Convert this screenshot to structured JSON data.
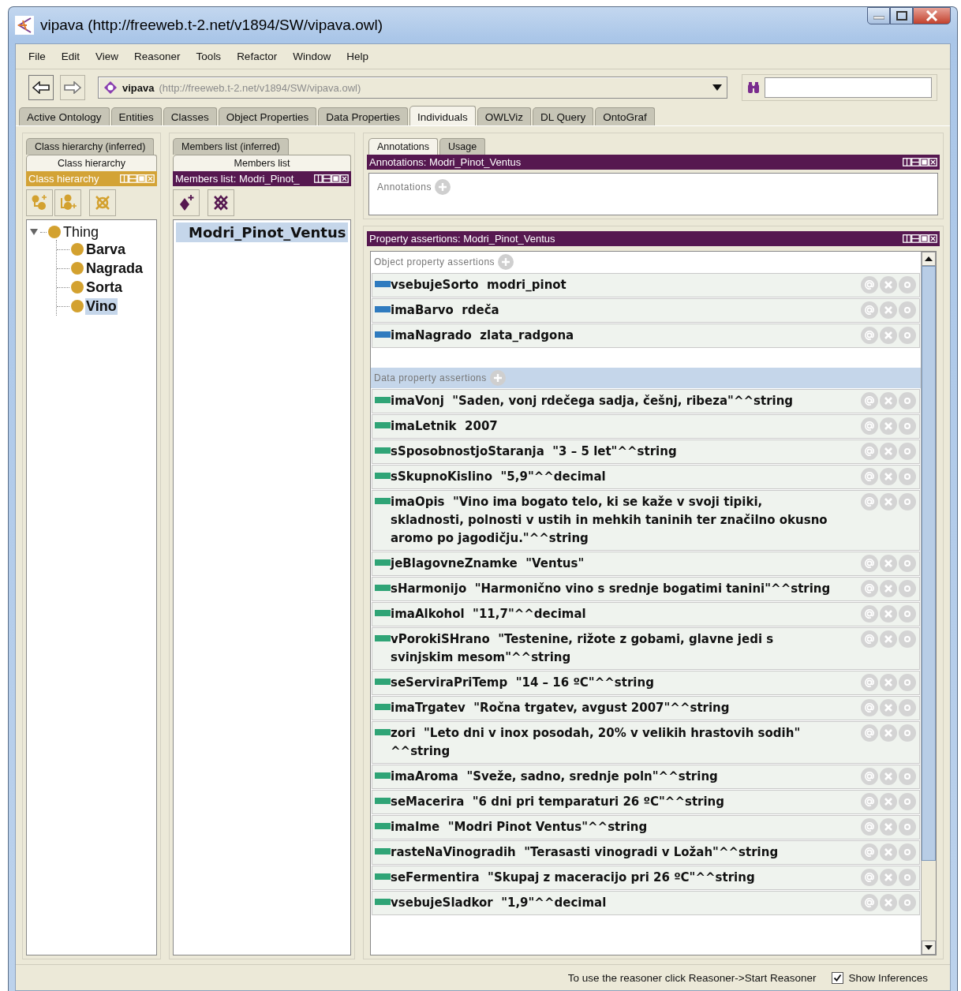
{
  "window": {
    "title": "vipava (http://freeweb.t-2.net/v1894/SW/vipava.owl)"
  },
  "menu": [
    "File",
    "Edit",
    "View",
    "Reasoner",
    "Tools",
    "Refactor",
    "Window",
    "Help"
  ],
  "toolbar": {
    "ontology_name": "vipava",
    "ontology_iri": "(http://freeweb.t-2.net/v1894/SW/vipava.owl)"
  },
  "tabs": [
    {
      "label": "Active Ontology",
      "selected": false
    },
    {
      "label": "Entities",
      "selected": false
    },
    {
      "label": "Classes",
      "selected": false
    },
    {
      "label": "Object Properties",
      "selected": false
    },
    {
      "label": "Data Properties",
      "selected": false
    },
    {
      "label": "Individuals",
      "selected": true
    },
    {
      "label": "OWLViz",
      "selected": false
    },
    {
      "label": "DL Query",
      "selected": false
    },
    {
      "label": "OntoGraf",
      "selected": false
    }
  ],
  "class_panel": {
    "tabs": [
      {
        "label": "Class hierarchy (inferred)",
        "selected": false
      },
      {
        "label": "Class hierarchy",
        "selected": true
      }
    ],
    "header": "Class hierarchy",
    "tree": [
      {
        "label": "Thing",
        "expanded": true,
        "selected": false,
        "children": [
          {
            "label": "Barva",
            "selected": false
          },
          {
            "label": "Nagrada",
            "selected": false
          },
          {
            "label": "Sorta",
            "selected": false
          },
          {
            "label": "Vino",
            "selected": true
          }
        ]
      }
    ]
  },
  "members_panel": {
    "tabs": [
      {
        "label": "Members list (inferred)",
        "selected": false
      },
      {
        "label": "Members list",
        "selected": true
      }
    ],
    "header": "Members list: Modri_Pinot_",
    "items": [
      {
        "label": "Modri_Pinot_Ventus",
        "selected": true
      }
    ]
  },
  "annotations_panel": {
    "tabs": [
      {
        "label": "Annotations",
        "selected": true
      },
      {
        "label": "Usage",
        "selected": false
      }
    ],
    "header": "Annotations: Modri_Pinot_Ventus",
    "section": "Annotations"
  },
  "assertions_panel": {
    "header": "Property assertions: Modri_Pinot_Ventus",
    "sections": [
      {
        "kind": "object",
        "title": "Object property assertions",
        "rows": [
          {
            "text": "vsebujeSorto  modri_pinot"
          },
          {
            "text": "imaBarvo  rdeča"
          },
          {
            "text": "imaNagrado  zlata_radgona"
          }
        ]
      },
      {
        "kind": "data",
        "title": "Data property assertions",
        "rows": [
          {
            "text": "imaVonj  \"Saden, vonj rdečega sadja, češnj, ribeza\"^^string"
          },
          {
            "text": "imaLetnik  2007"
          },
          {
            "text": "sSposobnostjoStaranja  \"3 – 5 let\"^^string"
          },
          {
            "text": "sSkupnoKislino  \"5,9\"^^decimal"
          },
          {
            "text": "imaOpis  \"Vino ima bogato telo, ki se kaže v svoji tipiki, skladnosti, polnosti v ustih in mehkih taninih ter značilno okusno aromo po jagodičju.\"^^string"
          },
          {
            "text": "jeBlagovneZnamke  \"Ventus\""
          },
          {
            "text": "sHarmonijo  \"Harmonično vino s srednje bogatimi tanini\"^^string"
          },
          {
            "text": "imaAlkohol  \"11,7\"^^decimal"
          },
          {
            "text": "vPorokiSHrano  \"Testenine, rižote z gobami, glavne jedi s svinjskim mesom\"^^string"
          },
          {
            "text": "seServiraPriTemp  \"14 – 16 ºC\"^^string"
          },
          {
            "text": "imaTrgatev  \"Ročna trgatev, avgust 2007\"^^string"
          },
          {
            "text": "zori  \"Leto dni v inox posodah, 20% v velikih hrastovih sodih\" ^^string"
          },
          {
            "text": "imaAroma  \"Sveže, sadno, srednje poln\"^^string"
          },
          {
            "text": "seMacerira  \"6 dni pri temparaturi 26 ºC\"^^string"
          },
          {
            "text": "imaIme  \"Modri Pinot Ventus\"^^string"
          },
          {
            "text": "rasteNaVinogradih  \"Terasasti vinogradi v Ložah\"^^string"
          },
          {
            "text": "seFermentira  \"Skupaj z maceracijo pri 26 ºC\"^^string"
          },
          {
            "text": "vsebujeSladkor  \"1,9\"^^decimal"
          }
        ]
      }
    ]
  },
  "status_bar": {
    "message": "To use the reasoner click Reasoner->Start Reasoner",
    "show_inferences": {
      "label": "Show Inferences",
      "checked": true
    }
  }
}
